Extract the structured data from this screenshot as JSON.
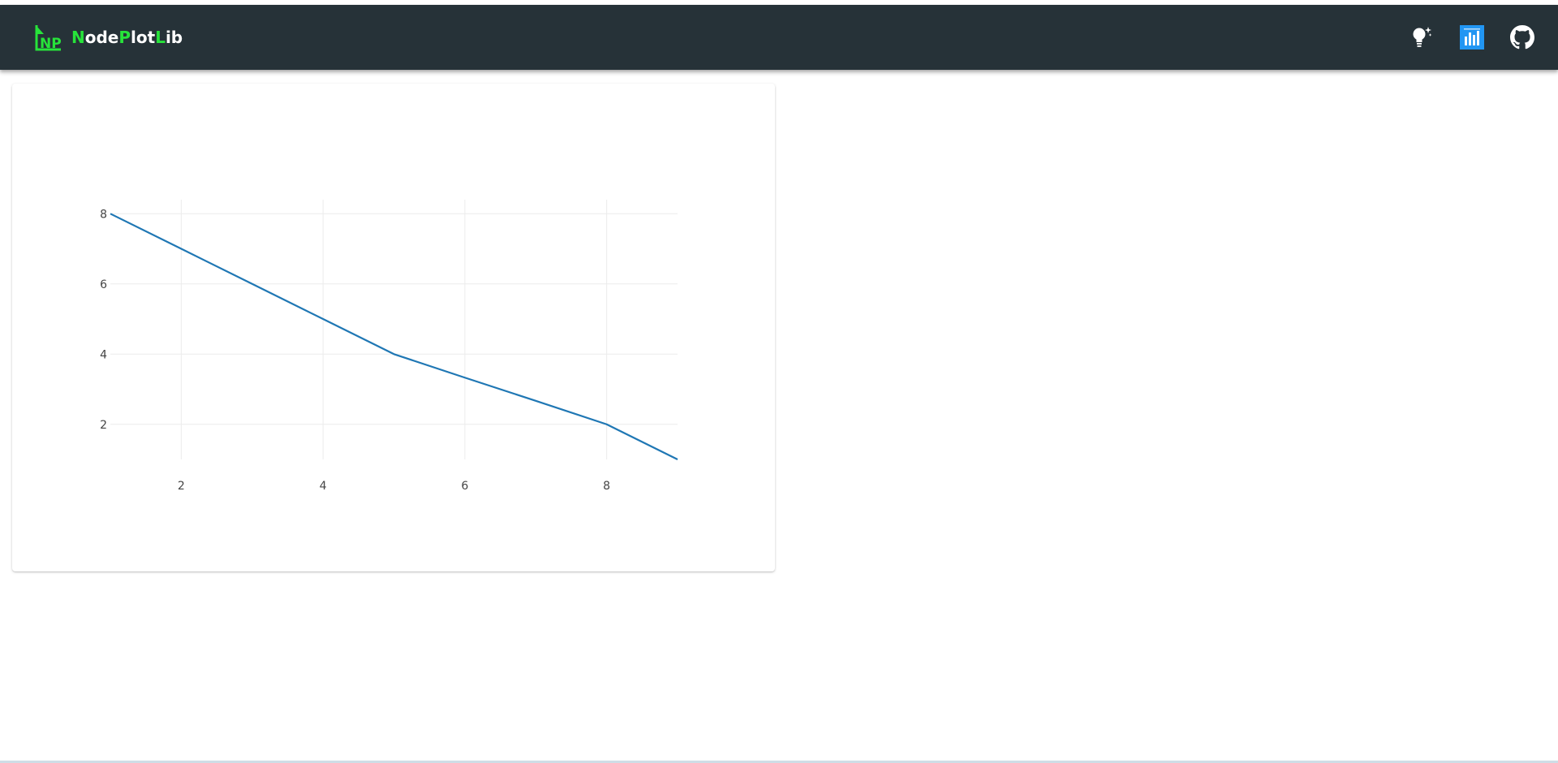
{
  "app": {
    "brand": {
      "parts": [
        {
          "text": "N",
          "accent": true
        },
        {
          "text": "ode",
          "accent": false
        },
        {
          "text": "P",
          "accent": true
        },
        {
          "text": "lot",
          "accent": false
        },
        {
          "text": "L",
          "accent": true
        },
        {
          "text": "ib",
          "accent": false
        }
      ],
      "logo_icon": "np-logo-icon",
      "accent_color": "#27e33a"
    },
    "header": {
      "background": "#263238",
      "actions": [
        {
          "name": "theme-toggle-button",
          "icon": "lightbulb-icon"
        },
        {
          "name": "plots-button",
          "icon": "bar-chart-icon",
          "color": "#2196f3"
        },
        {
          "name": "github-button",
          "icon": "github-icon"
        }
      ]
    }
  },
  "chart_data": {
    "type": "line",
    "series": [
      {
        "x": [
          1,
          2,
          3,
          4,
          5,
          6,
          7,
          8,
          9
        ],
        "y": [
          8,
          7,
          6,
          5,
          4,
          3.33,
          2.67,
          2,
          1
        ],
        "color": "#1f77b4"
      }
    ],
    "xlim": [
      1,
      9
    ],
    "ylim": [
      1,
      8.4
    ],
    "xticks": [
      2,
      4,
      6,
      8
    ],
    "yticks": [
      2,
      4,
      6,
      8
    ],
    "grid": true
  }
}
